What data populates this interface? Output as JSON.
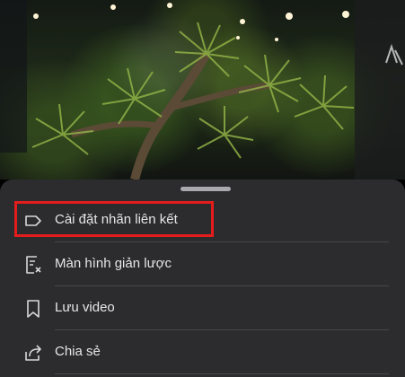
{
  "background": {
    "description_icon": "video-thumbnail"
  },
  "sheet": {
    "items": [
      {
        "label": "Cài đặt nhãn liên kết",
        "icon": "label-tag-icon"
      },
      {
        "label": "Màn hình giản lược",
        "icon": "simplified-screen-icon"
      },
      {
        "label": "Lưu video",
        "icon": "bookmark-icon"
      },
      {
        "label": "Chia sẻ",
        "icon": "share-icon"
      }
    ]
  },
  "colors": {
    "sheet_background": "#2c2c2e",
    "text": "#e6e6e8",
    "highlight": "#e41c1c"
  }
}
